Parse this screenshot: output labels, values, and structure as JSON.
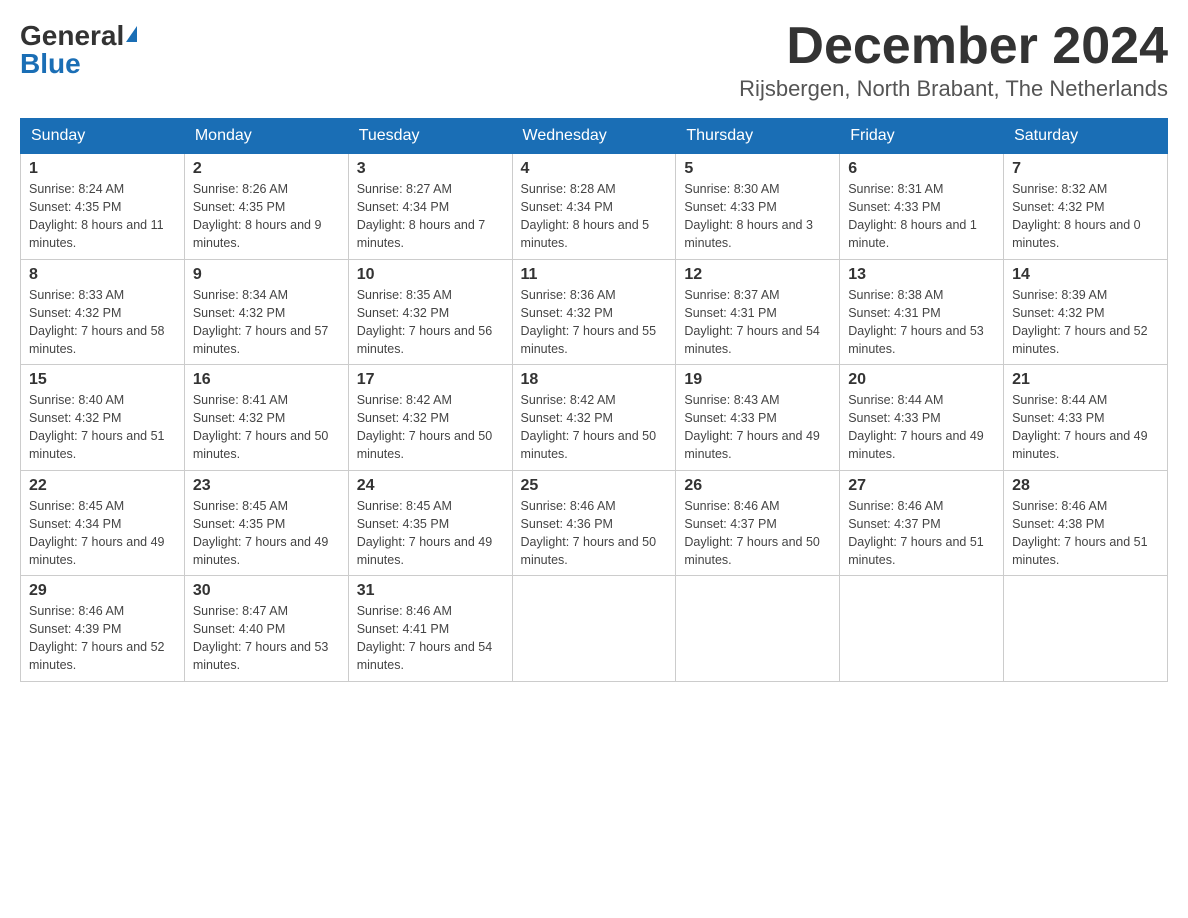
{
  "header": {
    "logo_general": "General",
    "logo_blue": "Blue",
    "title": "December 2024",
    "subtitle": "Rijsbergen, North Brabant, The Netherlands"
  },
  "days_of_week": [
    "Sunday",
    "Monday",
    "Tuesday",
    "Wednesday",
    "Thursday",
    "Friday",
    "Saturday"
  ],
  "weeks": [
    [
      {
        "day": "1",
        "sunrise": "Sunrise: 8:24 AM",
        "sunset": "Sunset: 4:35 PM",
        "daylight": "Daylight: 8 hours and 11 minutes."
      },
      {
        "day": "2",
        "sunrise": "Sunrise: 8:26 AM",
        "sunset": "Sunset: 4:35 PM",
        "daylight": "Daylight: 8 hours and 9 minutes."
      },
      {
        "day": "3",
        "sunrise": "Sunrise: 8:27 AM",
        "sunset": "Sunset: 4:34 PM",
        "daylight": "Daylight: 8 hours and 7 minutes."
      },
      {
        "day": "4",
        "sunrise": "Sunrise: 8:28 AM",
        "sunset": "Sunset: 4:34 PM",
        "daylight": "Daylight: 8 hours and 5 minutes."
      },
      {
        "day": "5",
        "sunrise": "Sunrise: 8:30 AM",
        "sunset": "Sunset: 4:33 PM",
        "daylight": "Daylight: 8 hours and 3 minutes."
      },
      {
        "day": "6",
        "sunrise": "Sunrise: 8:31 AM",
        "sunset": "Sunset: 4:33 PM",
        "daylight": "Daylight: 8 hours and 1 minute."
      },
      {
        "day": "7",
        "sunrise": "Sunrise: 8:32 AM",
        "sunset": "Sunset: 4:32 PM",
        "daylight": "Daylight: 8 hours and 0 minutes."
      }
    ],
    [
      {
        "day": "8",
        "sunrise": "Sunrise: 8:33 AM",
        "sunset": "Sunset: 4:32 PM",
        "daylight": "Daylight: 7 hours and 58 minutes."
      },
      {
        "day": "9",
        "sunrise": "Sunrise: 8:34 AM",
        "sunset": "Sunset: 4:32 PM",
        "daylight": "Daylight: 7 hours and 57 minutes."
      },
      {
        "day": "10",
        "sunrise": "Sunrise: 8:35 AM",
        "sunset": "Sunset: 4:32 PM",
        "daylight": "Daylight: 7 hours and 56 minutes."
      },
      {
        "day": "11",
        "sunrise": "Sunrise: 8:36 AM",
        "sunset": "Sunset: 4:32 PM",
        "daylight": "Daylight: 7 hours and 55 minutes."
      },
      {
        "day": "12",
        "sunrise": "Sunrise: 8:37 AM",
        "sunset": "Sunset: 4:31 PM",
        "daylight": "Daylight: 7 hours and 54 minutes."
      },
      {
        "day": "13",
        "sunrise": "Sunrise: 8:38 AM",
        "sunset": "Sunset: 4:31 PM",
        "daylight": "Daylight: 7 hours and 53 minutes."
      },
      {
        "day": "14",
        "sunrise": "Sunrise: 8:39 AM",
        "sunset": "Sunset: 4:32 PM",
        "daylight": "Daylight: 7 hours and 52 minutes."
      }
    ],
    [
      {
        "day": "15",
        "sunrise": "Sunrise: 8:40 AM",
        "sunset": "Sunset: 4:32 PM",
        "daylight": "Daylight: 7 hours and 51 minutes."
      },
      {
        "day": "16",
        "sunrise": "Sunrise: 8:41 AM",
        "sunset": "Sunset: 4:32 PM",
        "daylight": "Daylight: 7 hours and 50 minutes."
      },
      {
        "day": "17",
        "sunrise": "Sunrise: 8:42 AM",
        "sunset": "Sunset: 4:32 PM",
        "daylight": "Daylight: 7 hours and 50 minutes."
      },
      {
        "day": "18",
        "sunrise": "Sunrise: 8:42 AM",
        "sunset": "Sunset: 4:32 PM",
        "daylight": "Daylight: 7 hours and 50 minutes."
      },
      {
        "day": "19",
        "sunrise": "Sunrise: 8:43 AM",
        "sunset": "Sunset: 4:33 PM",
        "daylight": "Daylight: 7 hours and 49 minutes."
      },
      {
        "day": "20",
        "sunrise": "Sunrise: 8:44 AM",
        "sunset": "Sunset: 4:33 PM",
        "daylight": "Daylight: 7 hours and 49 minutes."
      },
      {
        "day": "21",
        "sunrise": "Sunrise: 8:44 AM",
        "sunset": "Sunset: 4:33 PM",
        "daylight": "Daylight: 7 hours and 49 minutes."
      }
    ],
    [
      {
        "day": "22",
        "sunrise": "Sunrise: 8:45 AM",
        "sunset": "Sunset: 4:34 PM",
        "daylight": "Daylight: 7 hours and 49 minutes."
      },
      {
        "day": "23",
        "sunrise": "Sunrise: 8:45 AM",
        "sunset": "Sunset: 4:35 PM",
        "daylight": "Daylight: 7 hours and 49 minutes."
      },
      {
        "day": "24",
        "sunrise": "Sunrise: 8:45 AM",
        "sunset": "Sunset: 4:35 PM",
        "daylight": "Daylight: 7 hours and 49 minutes."
      },
      {
        "day": "25",
        "sunrise": "Sunrise: 8:46 AM",
        "sunset": "Sunset: 4:36 PM",
        "daylight": "Daylight: 7 hours and 50 minutes."
      },
      {
        "day": "26",
        "sunrise": "Sunrise: 8:46 AM",
        "sunset": "Sunset: 4:37 PM",
        "daylight": "Daylight: 7 hours and 50 minutes."
      },
      {
        "day": "27",
        "sunrise": "Sunrise: 8:46 AM",
        "sunset": "Sunset: 4:37 PM",
        "daylight": "Daylight: 7 hours and 51 minutes."
      },
      {
        "day": "28",
        "sunrise": "Sunrise: 8:46 AM",
        "sunset": "Sunset: 4:38 PM",
        "daylight": "Daylight: 7 hours and 51 minutes."
      }
    ],
    [
      {
        "day": "29",
        "sunrise": "Sunrise: 8:46 AM",
        "sunset": "Sunset: 4:39 PM",
        "daylight": "Daylight: 7 hours and 52 minutes."
      },
      {
        "day": "30",
        "sunrise": "Sunrise: 8:47 AM",
        "sunset": "Sunset: 4:40 PM",
        "daylight": "Daylight: 7 hours and 53 minutes."
      },
      {
        "day": "31",
        "sunrise": "Sunrise: 8:46 AM",
        "sunset": "Sunset: 4:41 PM",
        "daylight": "Daylight: 7 hours and 54 minutes."
      },
      null,
      null,
      null,
      null
    ]
  ]
}
